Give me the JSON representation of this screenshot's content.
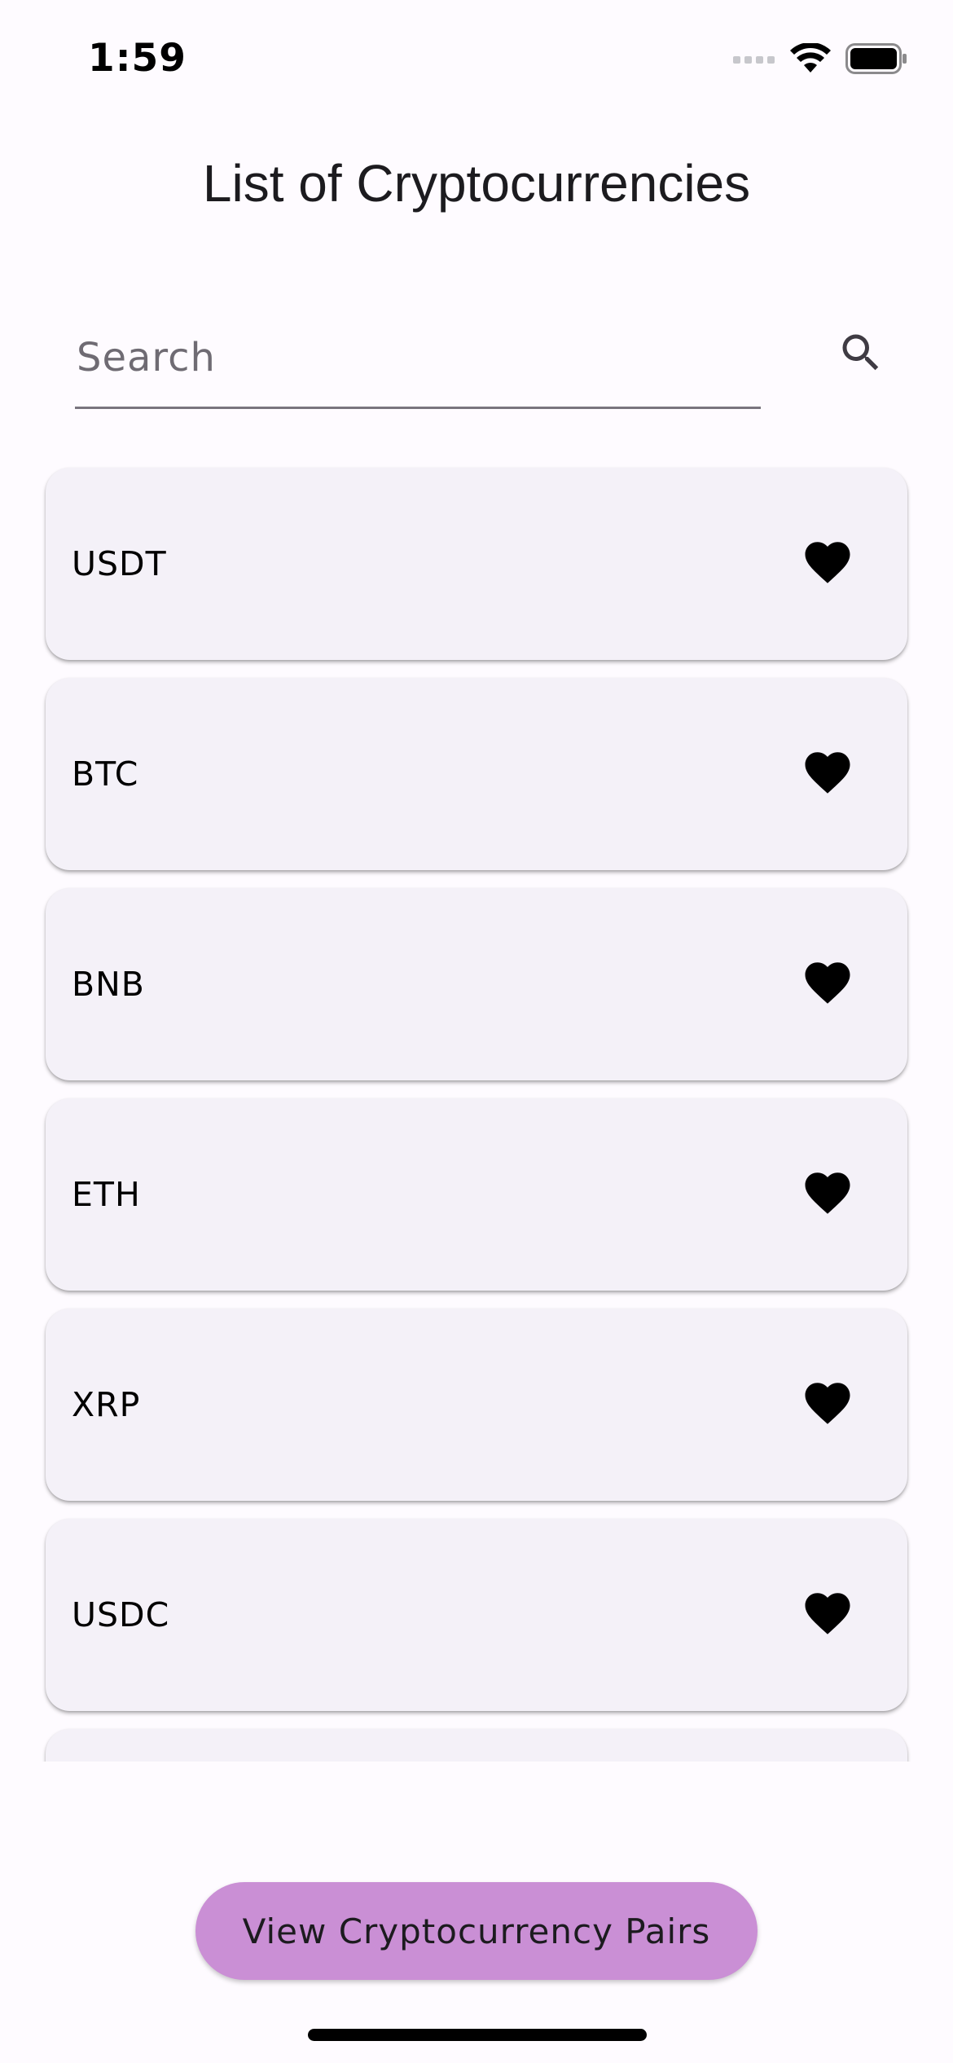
{
  "status_bar": {
    "time": "1:59",
    "icons": [
      "cellular-signal-icon",
      "wifi-icon",
      "battery-icon"
    ]
  },
  "title": "List of Cryptocurrencies",
  "search": {
    "placeholder": "Search",
    "value": "",
    "icon": "search-icon"
  },
  "list": {
    "items": [
      {
        "label": "USDT",
        "icon": "heart-icon"
      },
      {
        "label": "BTC",
        "icon": "heart-icon"
      },
      {
        "label": "BNB",
        "icon": "heart-icon"
      },
      {
        "label": "ETH",
        "icon": "heart-icon"
      },
      {
        "label": "XRP",
        "icon": "heart-icon"
      },
      {
        "label": "USDC",
        "icon": "heart-icon"
      },
      {
        "label": "",
        "icon": ""
      }
    ]
  },
  "actions": {
    "view_pairs_label": "View Cryptocurrency Pairs"
  },
  "colors": {
    "background": "#fefbff",
    "card": "#f4f1f8",
    "primary_button": "#ca8fd5",
    "divider": "#79747e",
    "icon": "#000000"
  }
}
